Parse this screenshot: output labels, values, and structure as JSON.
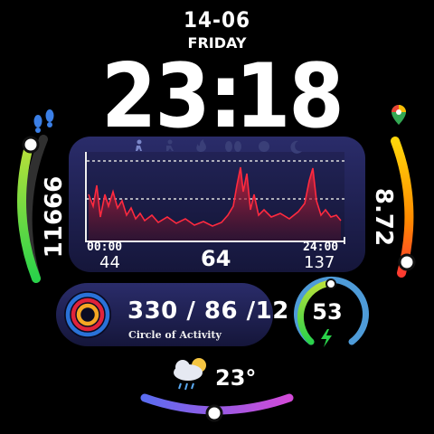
{
  "date": "14-06",
  "weekday": "FRIDAY",
  "time": {
    "hours": "23",
    "separator": ":",
    "minutes": "18"
  },
  "steps": {
    "value": "11666"
  },
  "distance": {
    "value": "8.72"
  },
  "heart_rate": {
    "start_time": "00:00",
    "end_time": "24:00",
    "min": "44",
    "current": "64",
    "max": "137",
    "tab_icons": [
      "walk-icon",
      "run-icon",
      "fire-icon",
      "lungs-icon",
      "stopwatch-icon",
      "sleep-icon"
    ]
  },
  "activity": {
    "values": "330 / 86 /12",
    "caption": "Circle of Activity"
  },
  "battery": {
    "value": "53"
  },
  "weather": {
    "temperature": "23°",
    "icon": "partly-cloudy-rain-icon"
  },
  "colors": {
    "accent_red": "#e0233a",
    "accent_blue": "#2a72d8",
    "gradient_left": [
      "#2ad24a",
      "#b8e03a"
    ],
    "gradient_right": [
      "#ff3b30",
      "#ffd60a"
    ],
    "weather_arc": [
      "#5b6cf0",
      "#d24ad8"
    ]
  }
}
